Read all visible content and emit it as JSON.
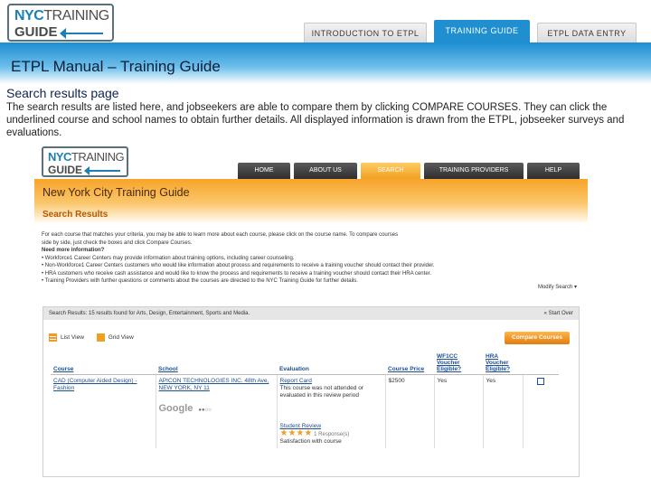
{
  "logo": {
    "line1_bold": "NYC",
    "line1_rest": "TRAINING",
    "line2": "GUIDE"
  },
  "slide_tabs": [
    "INTRODUCTION TO ETPL",
    "TRAINING GUIDE",
    "ETPL DATA ENTRY"
  ],
  "banner_title": "ETPL Manual – Training Guide",
  "section_heading": "Search results page",
  "description": "The search results are listed here, and jobseekers are able to compare them by clicking COMPARE COURSES.  They can click the underlined course and school names to obtain further details. All displayed information is drawn from the ETPL, jobseeker surveys and evaluations.",
  "site": {
    "logo": {
      "line1_bold": "NYC",
      "line1_rest": "TRAINING",
      "line2": "GUIDE"
    },
    "nav": [
      "HOME",
      "ABOUT US",
      "SEARCH",
      "TRAINING PROVIDERS",
      "HELP"
    ],
    "title": "New York City Training Guide",
    "subtitle": "Search Results",
    "intro_lines": [
      "For each course that matches your criteria, you may be able to learn more about each course, please click on the course name. To compare courses",
      "side by side, just check the boxes and click Compare Courses.",
      "Need more information?",
      "• Workforce1 Career Centers may provide information about training options, including career counseling.",
      "• Non-Workforce1 Career Centers customers who would like information about process and requirements to receive a training voucher should contact their provider.",
      "• HRA customers who receive cash assistance and would like to know the process and requirements to receive a training voucher should contact their HRA center.",
      "• Training Providers with further questions or comments about the courses are directed to the NYC Training Guide for further details."
    ],
    "modify_search": "Modify Search",
    "results_bar": "Search Results: 15 results found for Arts, Design, Entertainment, Sports and Media.",
    "start_over": "« Start Over",
    "list_view": "List View",
    "grid_view": "Grid View",
    "compare_button": "Compare Courses",
    "columns": [
      "Course",
      "School",
      "Evaluation",
      "Course Price",
      "WF1CC Voucher Eligible?",
      "HRA Voucher Eligible?"
    ],
    "row": {
      "course": "CAD (Computer Aided Design) - Fashion",
      "school": "APICON TECHNOLOGIES INC. 48th Ave, NEW YORK, NY 11",
      "evaluation_label": "Report Card",
      "evaluation_text": "This course was not attended or evaluated in this review period",
      "price": "$2500",
      "wf1cc": "Yes",
      "hra": "Yes",
      "google": "Google",
      "student_review": "Student Review",
      "responses": "1 Response(s)",
      "satisfaction": "Satisfaction with course"
    }
  }
}
